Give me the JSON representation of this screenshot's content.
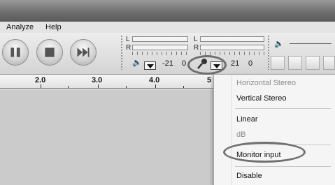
{
  "menubar": {
    "items": [
      "Analyze",
      "Help"
    ]
  },
  "transport": {
    "buttons": [
      "pause-icon",
      "stop-icon",
      "skip-end-icon"
    ]
  },
  "meters": {
    "left_channel": "L",
    "right_channel": "R",
    "playback_tick_a": "-21",
    "playback_tick_b": "0",
    "record_tick_a": "21",
    "record_tick_b": "0"
  },
  "ruler": {
    "labels": [
      "2.0",
      "3.0",
      "4.0",
      "5"
    ]
  },
  "context_menu": {
    "items": [
      {
        "label": "Horizontal Stereo",
        "disabled": true
      },
      {
        "label": "Vertical Stereo",
        "disabled": false
      },
      {
        "label": "Linear",
        "disabled": false
      },
      {
        "label": "dB",
        "disabled": true
      },
      {
        "label": "Monitor input",
        "disabled": false
      },
      {
        "label": "Disable",
        "disabled": false
      }
    ]
  },
  "colors": {
    "menu_bg": "#f5f5f5",
    "disabled_text": "#8a8a8a",
    "track_area": "#cbcbcb"
  }
}
